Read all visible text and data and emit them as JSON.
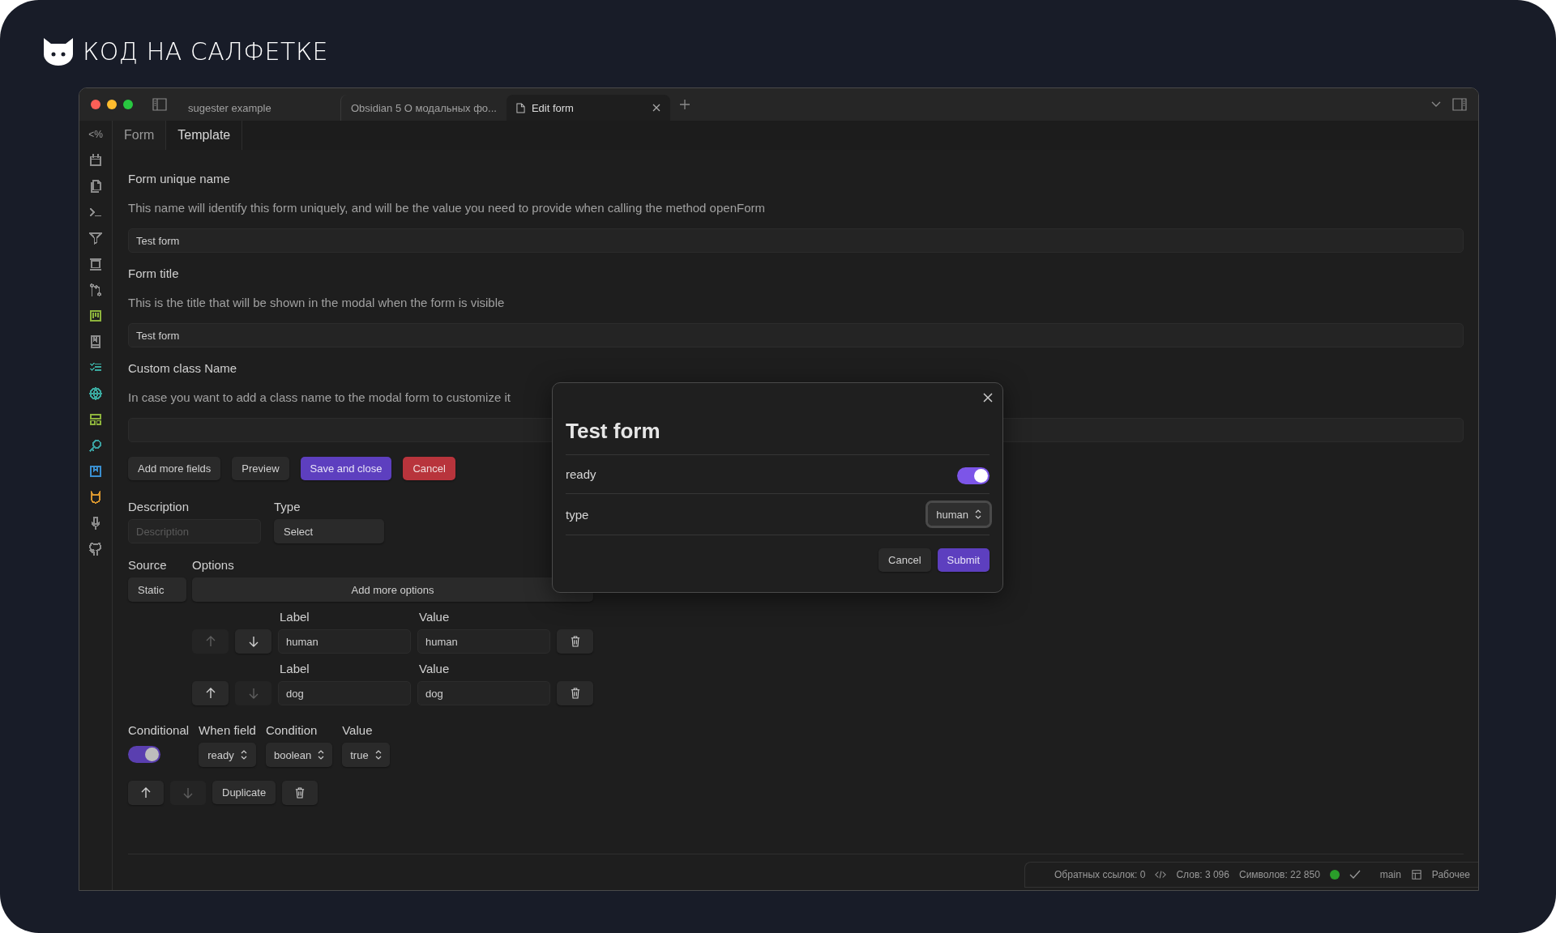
{
  "brand": {
    "name": "КОД НА САЛФЕТКЕ"
  },
  "titlebar": {
    "tabs": [
      {
        "title": "sugester example",
        "selected": false
      },
      {
        "title": "Obsidian 5 О модальных фо...",
        "selected": false
      },
      {
        "title": "Edit form",
        "selected": true
      }
    ]
  },
  "sidebar": {
    "header": "<%",
    "icons": [
      {
        "color": "#8c8c8c"
      },
      {
        "color": "#8c8c8c"
      },
      {
        "color": "#8c8c8c"
      },
      {
        "color": "#8c8c8c"
      },
      {
        "color": "#8c8c8c"
      },
      {
        "color": "#8c8c8c"
      },
      {
        "color": "#8db33c"
      },
      {
        "color": "#8c8c8c"
      },
      {
        "color": "#3aa89e"
      },
      {
        "color": "#3aa89e"
      },
      {
        "color": "#8db33c"
      },
      {
        "color": "#3aa0a0"
      },
      {
        "color": "#3a8fd0"
      },
      {
        "color": "#d9962e"
      },
      {
        "color": "#8c8c8c"
      },
      {
        "color": "#8c8c8c"
      }
    ]
  },
  "editor_tabs": [
    {
      "label": "Form",
      "selected": false
    },
    {
      "label": "Template",
      "selected": true
    }
  ],
  "settings": [
    {
      "label": "Form unique name",
      "description": "This name will identify this form uniquely, and will be the value you need to provide when calling the method openForm",
      "value": "Test form"
    },
    {
      "label": "Form title",
      "description": "This is the title that will be shown in the modal when the form is visible",
      "value": "Test form"
    },
    {
      "label": "Custom class Name",
      "description": "In case you want to add a class name to the modal form to customize it"
    }
  ],
  "actions": [
    {
      "label": "Add more fields",
      "kind": "default"
    },
    {
      "label": "Preview",
      "kind": "default"
    },
    {
      "label": "Save and close",
      "kind": "primary"
    },
    {
      "label": "Cancel",
      "kind": "danger"
    }
  ],
  "field": {
    "description_label": "Description",
    "description_placeholder": "Description",
    "type_label": "Type",
    "type_value": "Select",
    "source_label": "Source",
    "source_value": "Static",
    "options_label": "Options",
    "add_options": "Add more options",
    "options": [
      {
        "label_heading": "Label",
        "value_heading": "Value",
        "label": "human",
        "value": "human",
        "up_disabled": true,
        "down_disabled": false
      },
      {
        "label_heading": "Label",
        "value_heading": "Value",
        "label": "dog",
        "value": "dog",
        "up_disabled": false,
        "down_disabled": true
      }
    ],
    "conditional": {
      "label": "Conditional",
      "on": true,
      "when_field_label": "When field",
      "when_field": "ready",
      "condition_label": "Condition",
      "condition": "boolean",
      "value_label": "Value",
      "value": "true"
    },
    "footer": {
      "up_disabled": false,
      "down_disabled": true,
      "duplicate": "Duplicate"
    }
  },
  "modal": {
    "title": "Test form",
    "fields": [
      {
        "kind": "toggle",
        "label": "ready",
        "on": true
      },
      {
        "kind": "select",
        "label": "type",
        "value": "human",
        "focused": true
      }
    ],
    "buttons": [
      {
        "label": "Cancel",
        "kind": "default"
      },
      {
        "label": "Submit",
        "kind": "primary"
      }
    ]
  },
  "status_bar": {
    "backlinks": "Обратных ссылок: 0",
    "words": "Слов: 3 096",
    "chars": "Символов: 22 850",
    "sync": {
      "color": "#2a9d2a"
    },
    "branch": "main",
    "workspace": "Рабочее"
  }
}
